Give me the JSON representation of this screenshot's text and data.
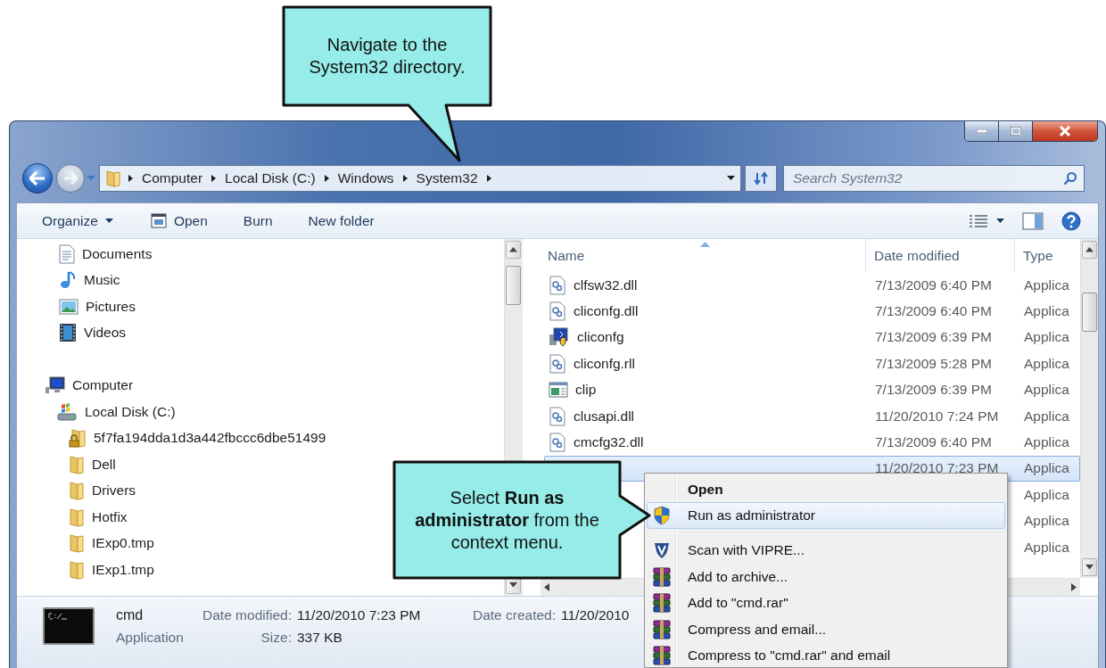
{
  "callouts": [
    {
      "text": "Navigate to the System32 directory."
    },
    {
      "text": "Select **Run as administrator** from the context menu."
    }
  ],
  "address_bar": {
    "path": [
      "Computer",
      "Local Disk (C:)",
      "Windows",
      "System32"
    ]
  },
  "search": {
    "placeholder": "Search System32"
  },
  "toolbar": {
    "buttons": [
      {
        "label": "Organize",
        "kind": "dropdown"
      },
      {
        "label": "Open",
        "kind": "with-icon"
      },
      {
        "label": "Burn",
        "kind": "plain"
      },
      {
        "label": "New folder",
        "kind": "plain"
      }
    ]
  },
  "sidebar": {
    "libraries": [
      {
        "label": "Documents",
        "kind": "documents"
      },
      {
        "label": "Music",
        "kind": "music"
      },
      {
        "label": "Pictures",
        "kind": "pictures"
      },
      {
        "label": "Videos",
        "kind": "videos"
      }
    ],
    "tree": [
      {
        "label": "Computer",
        "kind": "computer",
        "children": [
          {
            "label": "Local Disk (C:)",
            "kind": "drive",
            "children": [
              {
                "label": "5f7fa194dda1d3a442fbccc6dbe51499",
                "kind": "locked-folder"
              },
              {
                "label": "Dell",
                "kind": "folder"
              },
              {
                "label": "Drivers",
                "kind": "folder"
              },
              {
                "label": "Hotfix",
                "kind": "folder"
              },
              {
                "label": "IExp0.tmp",
                "kind": "folder"
              },
              {
                "label": "IExp1.tmp",
                "kind": "folder"
              }
            ]
          }
        ]
      }
    ]
  },
  "file_list": {
    "columns": [
      "Name",
      "Date modified",
      "Type"
    ],
    "rows": [
      {
        "name": "clfsw32.dll",
        "kind": "dll",
        "date": "7/13/2009 6:40 PM",
        "type": "Applica",
        "selected": false
      },
      {
        "name": "cliconfg.dll",
        "kind": "dll",
        "date": "7/13/2009 6:40 PM",
        "type": "Applica",
        "selected": false
      },
      {
        "name": "cliconfg",
        "kind": "app",
        "date": "7/13/2009 6:39 PM",
        "type": "Applica",
        "selected": false
      },
      {
        "name": "cliconfg.rll",
        "kind": "dll",
        "date": "7/13/2009 5:28 PM",
        "type": "Applica",
        "selected": false
      },
      {
        "name": "clip",
        "kind": "console",
        "date": "7/13/2009 6:39 PM",
        "type": "Applica",
        "selected": false
      },
      {
        "name": "clusapi.dll",
        "kind": "dll",
        "date": "11/20/2010 7:24 PM",
        "type": "Applica",
        "selected": false
      },
      {
        "name": "cmcfg32.dll",
        "kind": "dll",
        "date": "7/13/2009 6:40 PM",
        "type": "Applica",
        "selected": false
      },
      {
        "date": "11/20/2010 7:23 PM",
        "type": "Applica",
        "selected": true
      },
      {
        "type": "Applica",
        "selected": false
      },
      {
        "type": "Applica",
        "selected": false
      },
      {
        "type": "Applica",
        "selected": false
      }
    ]
  },
  "details": {
    "name": "cmd",
    "type": "Application",
    "fields": [
      {
        "label": "Date modified:",
        "value": "11/20/2010 7:23 PM"
      },
      {
        "label": "Size:",
        "value": "337 KB"
      },
      {
        "label": "Date created:",
        "value": "11/20/2010"
      }
    ]
  },
  "context_menu": {
    "items": [
      {
        "label": "Open",
        "kind": "default",
        "selected": false
      },
      {
        "label": "Run as administrator",
        "kind": "shield",
        "selected": true
      },
      {
        "label": "Scan with VIPRE...",
        "kind": "vipre",
        "separator_before": true,
        "selected": false
      },
      {
        "label": "Add to archive...",
        "kind": "archive",
        "selected": false
      },
      {
        "label": "Add to \"cmd.rar\"",
        "kind": "archive",
        "selected": false
      },
      {
        "label": "Compress and email...",
        "kind": "archive",
        "selected": false
      },
      {
        "label": "Compress to \"cmd.rar\" and email",
        "kind": "archive",
        "selected": false
      }
    ]
  }
}
